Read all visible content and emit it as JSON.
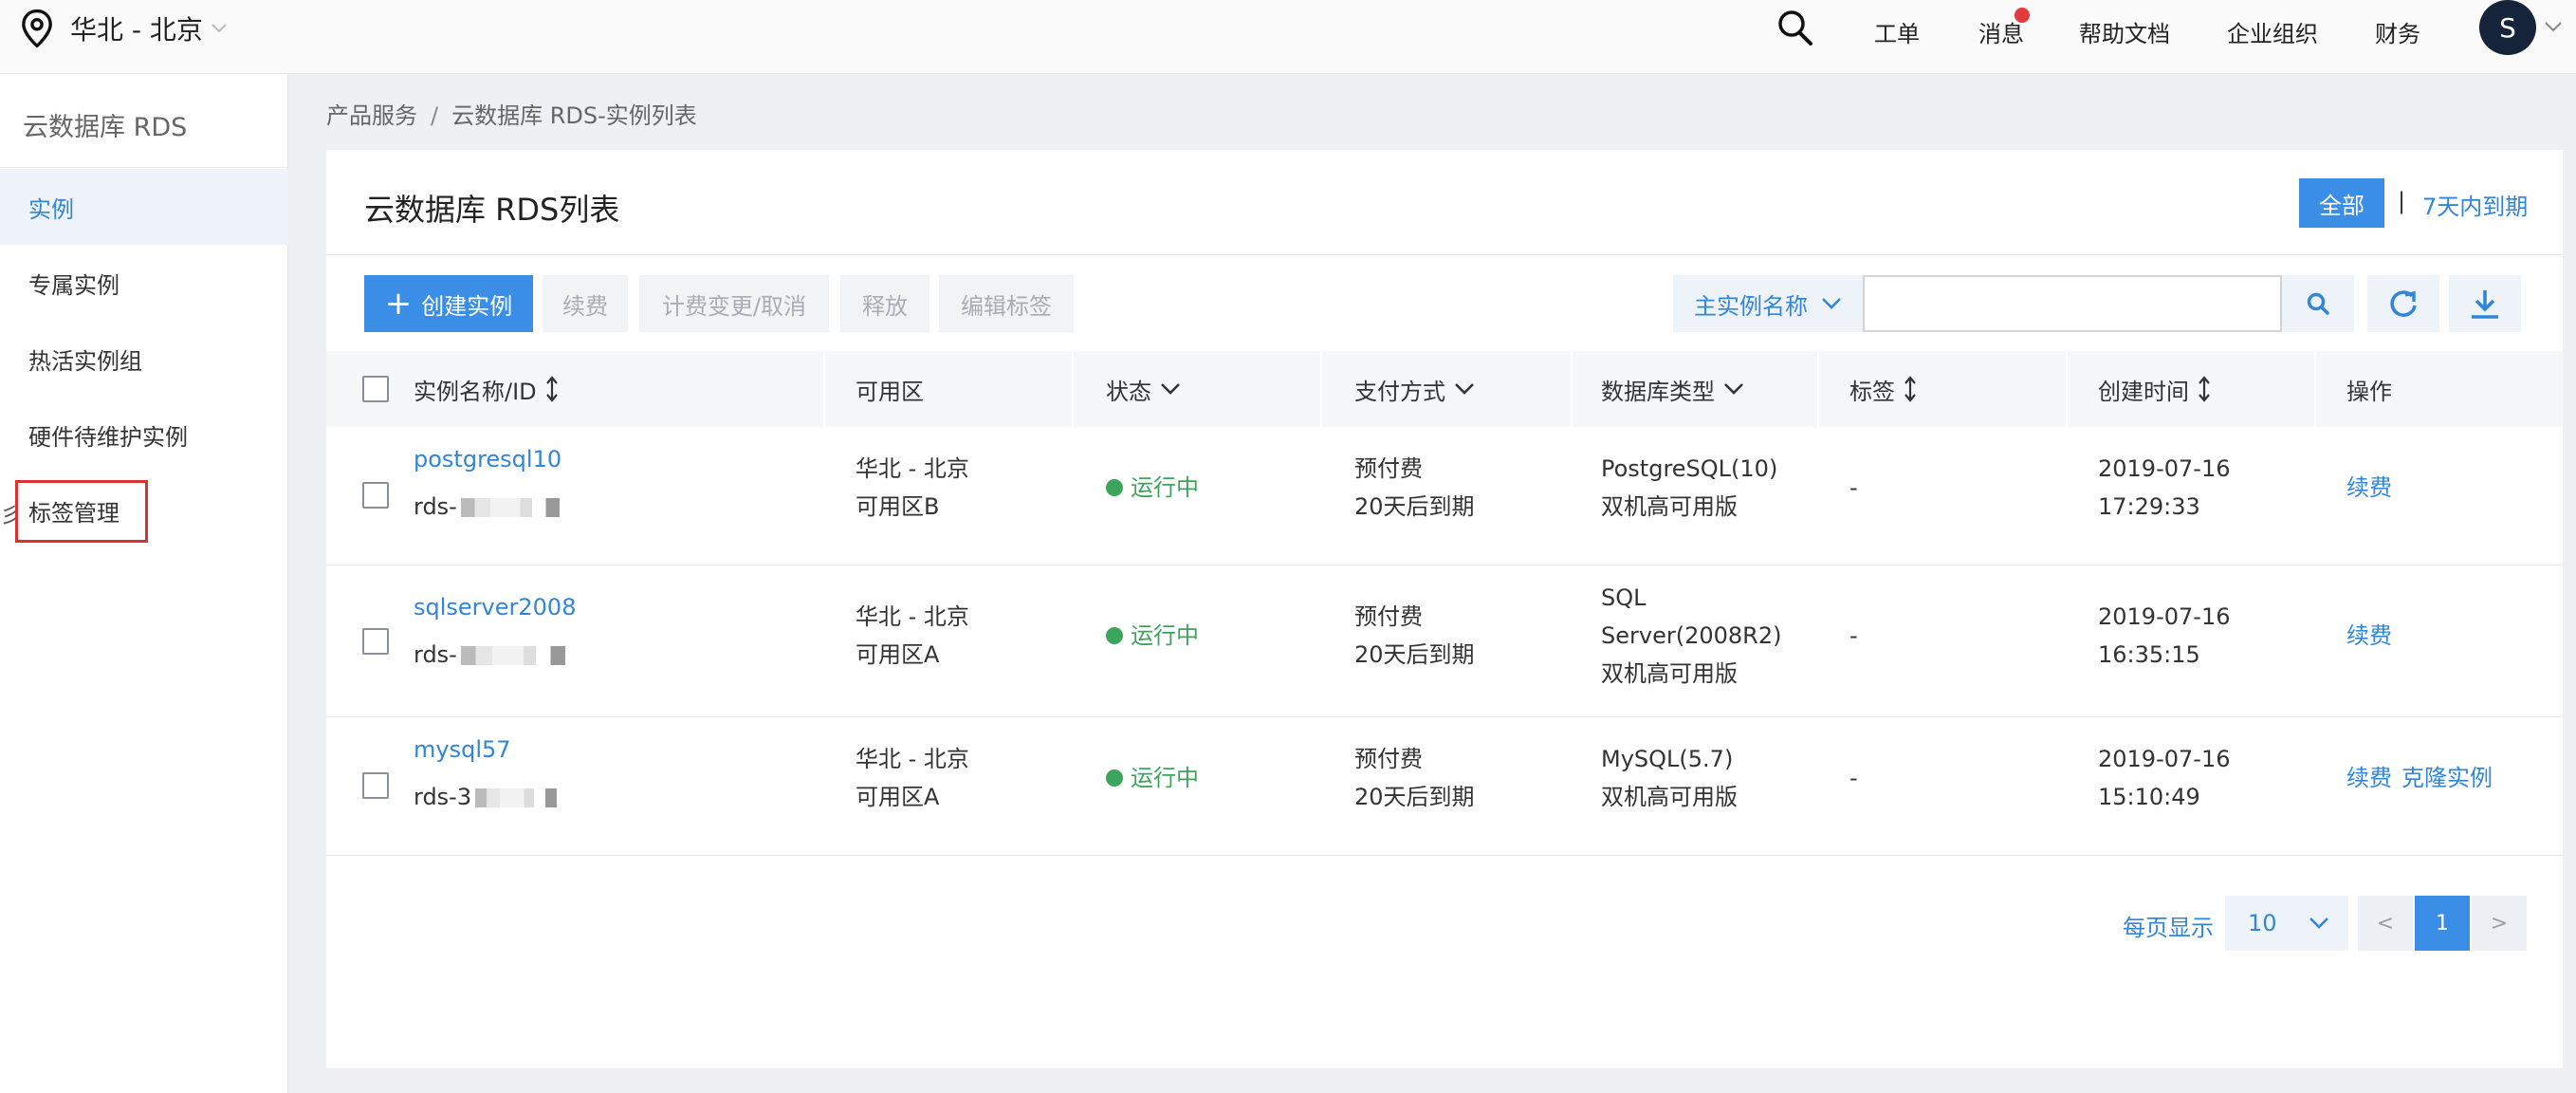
{
  "header": {
    "region": "华北 - 北京",
    "nav": [
      "工单",
      "消息",
      "帮助文档",
      "企业组织",
      "财务"
    ],
    "avatar_initial": "S"
  },
  "sidebar": {
    "title": "云数据库 RDS",
    "items": [
      {
        "label": "实例",
        "active": true
      },
      {
        "label": "专属实例",
        "active": false
      },
      {
        "label": "热活实例组",
        "active": false
      },
      {
        "label": "硬件待维护实例",
        "active": false
      },
      {
        "label": "标签管理",
        "active": false
      }
    ],
    "marker": "彡"
  },
  "breadcrumb": [
    "产品服务",
    "云数据库 RDS-实例列表"
  ],
  "panel": {
    "title": "云数据库 RDS列表",
    "filters": {
      "all": "全部",
      "sep": "|",
      "expiring": "7天内到期"
    }
  },
  "toolbar": {
    "create": "创建实例",
    "renew": "续费",
    "billing_change": "计费变更/取消",
    "release": "释放",
    "edit_tags": "编辑标签",
    "search_field": "主实例名称",
    "search_value": ""
  },
  "table": {
    "columns": [
      "实例名称/ID",
      "可用区",
      "状态",
      "支付方式",
      "数据库类型",
      "标签",
      "创建时间",
      "操作"
    ],
    "rows": [
      {
        "name": "postgresql10",
        "id": "rds-",
        "zone": [
          "华北 - 北京",
          "可用区B"
        ],
        "status": "运行中",
        "payment": [
          "预付费",
          "20天后到期"
        ],
        "db_type": [
          "PostgreSQL(10)",
          "双机高可用版"
        ],
        "tag": "-",
        "created": [
          "2019-07-16",
          "17:29:33"
        ],
        "actions": [
          "续费"
        ]
      },
      {
        "name": "sqlserver2008",
        "id": "rds-",
        "zone": [
          "华北 - 北京",
          "可用区A"
        ],
        "status": "运行中",
        "payment": [
          "预付费",
          "20天后到期"
        ],
        "db_type": [
          "SQL",
          "Server(2008R2)",
          "双机高可用版"
        ],
        "tag": "-",
        "created": [
          "2019-07-16",
          "16:35:15"
        ],
        "actions": [
          "续费"
        ]
      },
      {
        "name": "mysql57",
        "id": "rds-3",
        "zone": [
          "华北 - 北京",
          "可用区A"
        ],
        "status": "运行中",
        "payment": [
          "预付费",
          "20天后到期"
        ],
        "db_type": [
          "MySQL(5.7)",
          "双机高可用版"
        ],
        "tag": "-",
        "created": [
          "2019-07-16",
          "15:10:49"
        ],
        "actions": [
          "续费",
          "克隆实例"
        ]
      }
    ]
  },
  "pagination": {
    "per_page_label": "每页显示",
    "per_page": "10",
    "prev": "<",
    "current": "1",
    "next": ">"
  },
  "colors": {
    "primary": "#3a8ee6",
    "link": "#3186d9",
    "running": "#3ca55c",
    "highlight_border": "#d93030"
  }
}
